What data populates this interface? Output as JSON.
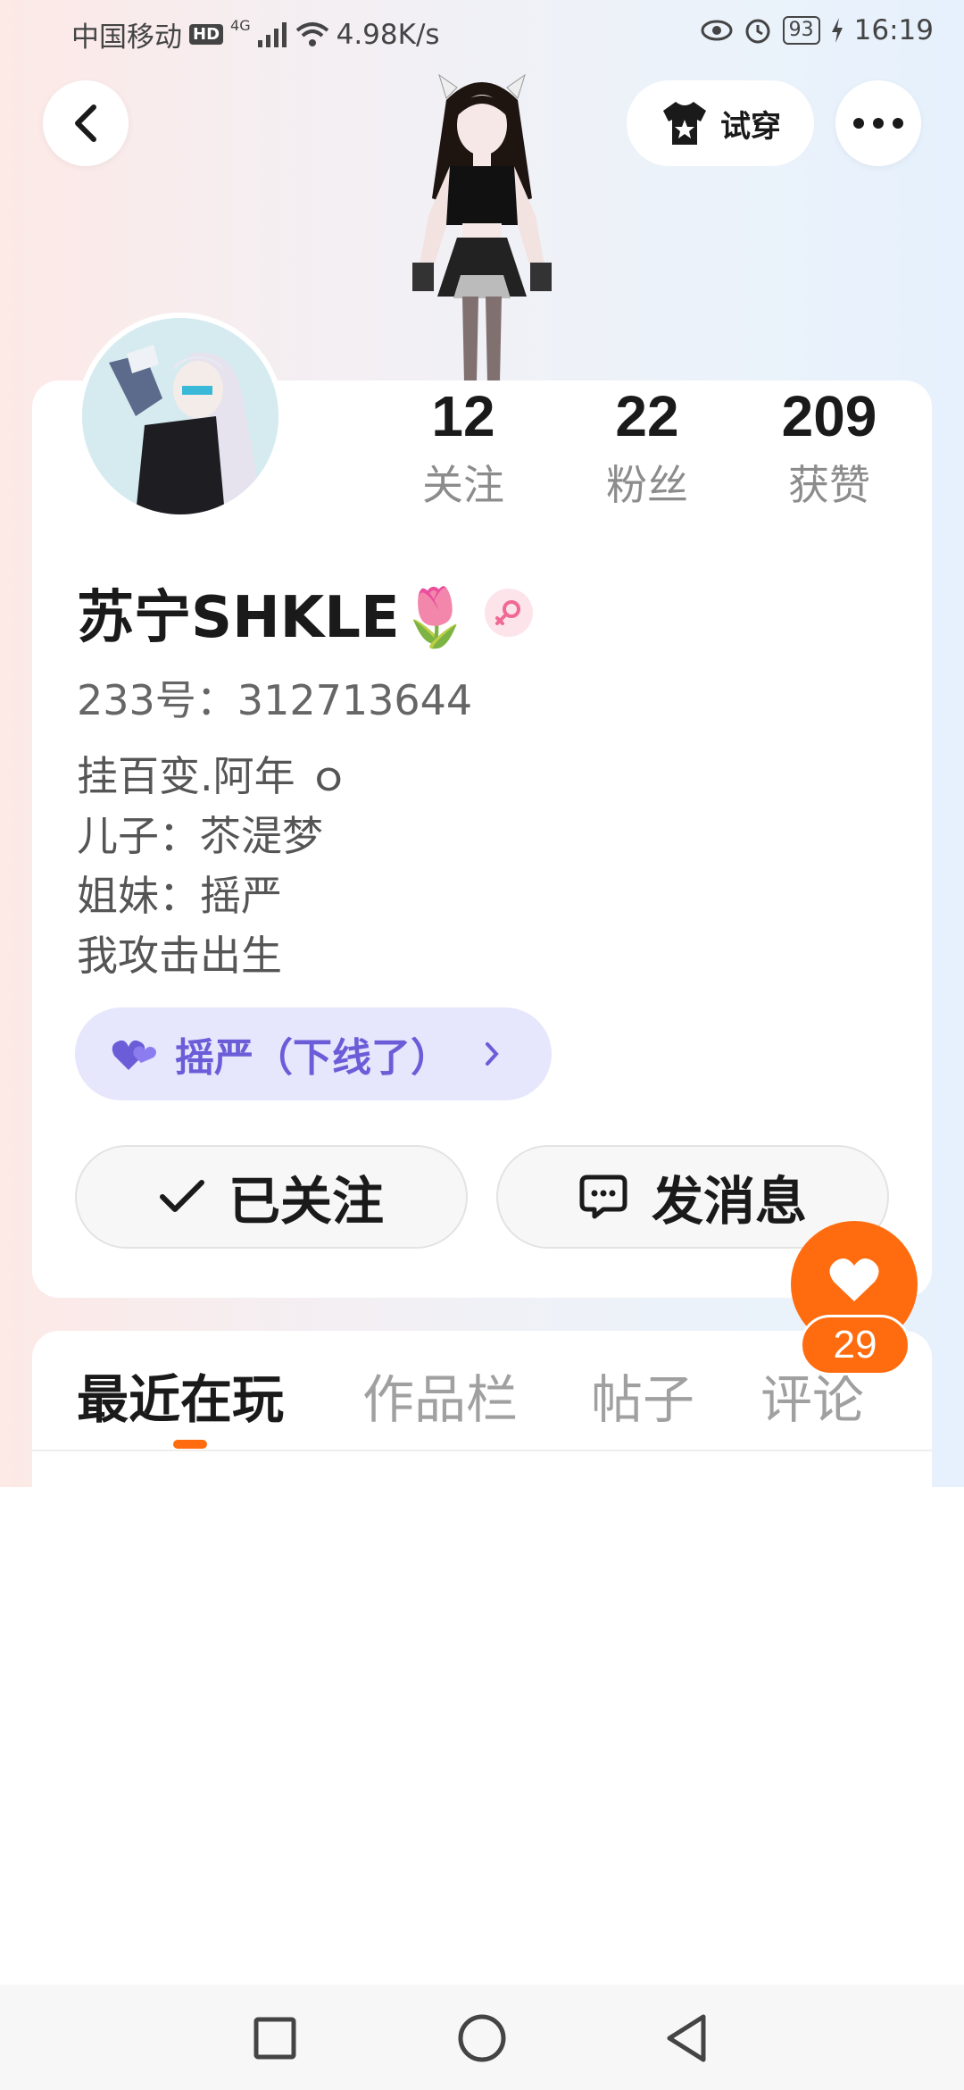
{
  "status_bar": {
    "carrier": "中国移动",
    "hd": "HD",
    "network": "4G",
    "speed": "4.98K/s",
    "battery": "93",
    "time": "16:19"
  },
  "header": {
    "try_on_label": "试穿"
  },
  "profile": {
    "stats": [
      {
        "value": "12",
        "label": "关注"
      },
      {
        "value": "22",
        "label": "粉丝"
      },
      {
        "value": "209",
        "label": "获赞"
      }
    ],
    "username": "苏宁SHKLE🌷",
    "uid": "233号：312713644",
    "bio": [
      "挂百变.阿年 ｏ",
      "儿子：苶湜梦",
      "姐妹：摇严",
      "我攻击出生"
    ],
    "cp_label": "摇严（下线了）"
  },
  "actions": {
    "follow_label": "已关注",
    "message_label": "发消息"
  },
  "like": {
    "count": "29"
  },
  "tabs": [
    {
      "label": "最近在玩",
      "active": true
    },
    {
      "label": "作品栏",
      "active": false
    },
    {
      "label": "帖子",
      "active": false
    },
    {
      "label": "评论",
      "active": false
    }
  ],
  "colors": {
    "accent": "#ff6c10",
    "cp_bg": "#e6e6fc",
    "cp_text": "#6b5dd8"
  },
  "icons": {
    "back": "chevron-left-icon",
    "try_on": "shirt-star-icon",
    "more": "more-dots-icon",
    "gender": "female-icon",
    "cp_heart": "hearts-icon",
    "follow_check": "check-icon",
    "message": "chat-bubble-icon",
    "like": "heart-icon"
  }
}
